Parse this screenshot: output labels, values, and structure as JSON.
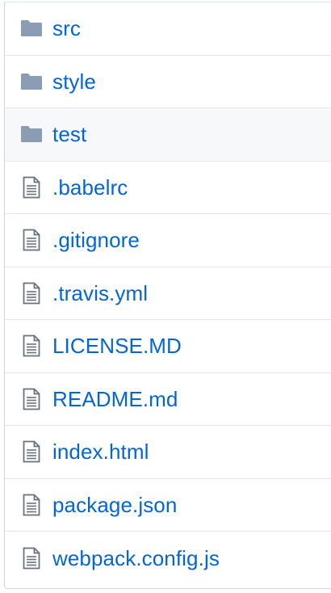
{
  "colors": {
    "link": "#0366d6",
    "folder_icon": "#8a9db4",
    "file_icon": "#6a737d",
    "row_divider": "#e3e6ea",
    "highlight_row": "#f6f8fa"
  },
  "files": [
    {
      "name": "src",
      "type": "folder",
      "icon": "folder-icon"
    },
    {
      "name": "style",
      "type": "folder",
      "icon": "folder-icon"
    },
    {
      "name": "test",
      "type": "folder",
      "icon": "folder-icon",
      "highlighted": true
    },
    {
      "name": ".babelrc",
      "type": "file",
      "icon": "file-text-icon"
    },
    {
      "name": ".gitignore",
      "type": "file",
      "icon": "file-text-icon"
    },
    {
      "name": ".travis.yml",
      "type": "file",
      "icon": "file-text-icon"
    },
    {
      "name": "LICENSE.MD",
      "type": "file",
      "icon": "file-text-icon"
    },
    {
      "name": "README.md",
      "type": "file",
      "icon": "file-text-icon"
    },
    {
      "name": "index.html",
      "type": "file",
      "icon": "file-text-icon"
    },
    {
      "name": "package.json",
      "type": "file",
      "icon": "file-text-icon"
    },
    {
      "name": "webpack.config.js",
      "type": "file",
      "icon": "file-text-icon"
    }
  ]
}
